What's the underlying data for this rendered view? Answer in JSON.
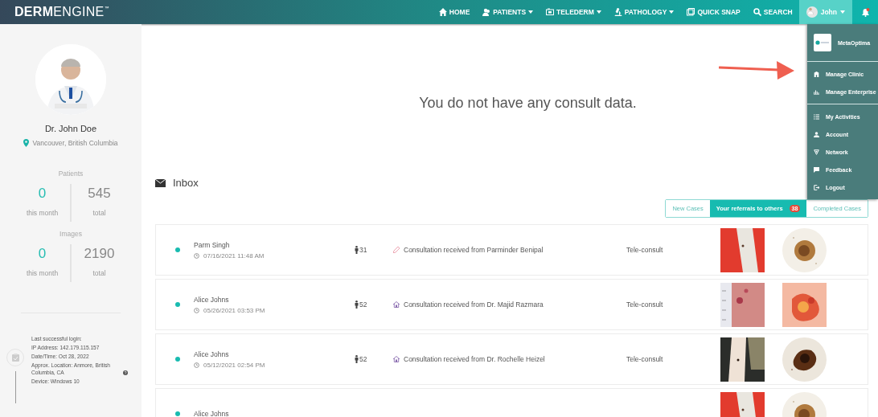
{
  "navbar": {
    "logo": {
      "strong": "DERM",
      "light": "ENGINE",
      "mark": "™"
    },
    "items": [
      {
        "label": "HOME",
        "caret": false
      },
      {
        "label": "PATIENTS",
        "caret": true
      },
      {
        "label": "TELEDERM",
        "caret": true
      },
      {
        "label": "PATHOLOGY",
        "caret": true
      },
      {
        "label": "QUICK SNAP",
        "caret": false
      },
      {
        "label": "SEARCH",
        "caret": false
      }
    ],
    "user": {
      "name": "John",
      "expanded": true
    },
    "notification": {
      "unread": true
    }
  },
  "user_menu": {
    "organization": "MetaOptima",
    "groups": [
      [
        {
          "label": "Manage Clinic"
        },
        {
          "label": "Manage Enterprise"
        }
      ],
      [
        {
          "label": "My Activities"
        },
        {
          "label": "Account"
        },
        {
          "label": "Network"
        },
        {
          "label": "Feedback"
        },
        {
          "label": "Logout"
        }
      ]
    ]
  },
  "sidebar": {
    "profile": {
      "name": "Dr. John Doe",
      "location": "Vancouver, British Columbia"
    },
    "stats": [
      {
        "title": "Patients",
        "month_value": "0",
        "month_label": "this month",
        "total_value": "545",
        "total_label": "total"
      },
      {
        "title": "Images",
        "month_value": "0",
        "month_label": "this month",
        "total_value": "2190",
        "total_label": "total"
      }
    ],
    "last_login": [
      "Last successful login:",
      "IP Address: 142.179.115.157",
      "Date/Time: Oct 28, 2022",
      "Approx. Location: Anmore, British Columbia, CA",
      "Device: Windows 10"
    ]
  },
  "empty_message": "You do not have any consult data.",
  "inbox": {
    "title": "Inbox",
    "tabs": [
      {
        "label": "New Cases",
        "selected": false
      },
      {
        "label": "Your referrals to others",
        "selected": true,
        "badge": "38"
      },
      {
        "label": "Completed Cases",
        "selected": false
      }
    ],
    "rows": [
      {
        "patient": "Parm Singh",
        "datetime": "07/16/2021 11:48 AM",
        "age": "31",
        "consultation": {
          "kind": "pencil",
          "text": "Consultation received from Parminder Benipal"
        },
        "type": "Tele-consult"
      },
      {
        "patient": "Alice Johns",
        "datetime": "05/26/2021 03:53 PM",
        "age": "52",
        "consultation": {
          "kind": "clinic",
          "text": "Consultation received from Dr. Majid Razmara"
        },
        "type": "Tele-consult"
      },
      {
        "patient": "Alice Johns",
        "datetime": "05/12/2021 02:54 PM",
        "age": "52",
        "consultation": {
          "kind": "clinic",
          "text": "Consultation received from Dr. Rochelle Heizel"
        },
        "type": "Tele-consult"
      },
      {
        "patient": "Alice Johns"
      }
    ]
  }
}
